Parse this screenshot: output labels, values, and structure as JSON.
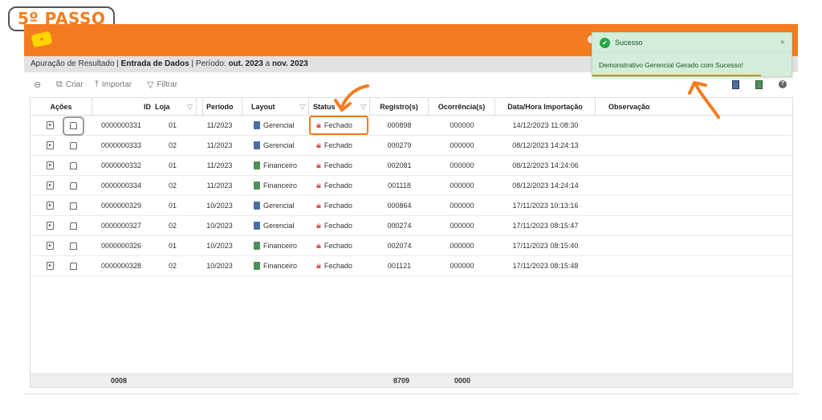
{
  "step_badge": "5º PASSO",
  "breadcrumb": {
    "prefix": "Apuração de Resultado | ",
    "section": "Entrada de Dados",
    "period_label": " | Período: ",
    "period_start": "out. 2023",
    "period_sep": " a ",
    "period_end": "nov. 2023"
  },
  "toolbar": {
    "create_label": "Criar",
    "import_label": "Importar",
    "filter_label": "Filtrar"
  },
  "table": {
    "columns": [
      "Ações",
      "ID",
      "Loja",
      "Período",
      "Layout",
      "Status",
      "Registro(s)",
      "Ocorrência(s)",
      "Data/Hora Importação",
      "Observação"
    ],
    "rows": [
      {
        "id": "0000000331",
        "loja": "01",
        "periodo": "11/2023",
        "layout": "Gerencial",
        "status": "Fechado",
        "registros": "000898",
        "ocorrencias": "000000",
        "datahora": "14/12/2023 11:08:30",
        "obs": ""
      },
      {
        "id": "0000000333",
        "loja": "02",
        "periodo": "11/2023",
        "layout": "Gerencial",
        "status": "Fechado",
        "registros": "000279",
        "ocorrencias": "000000",
        "datahora": "08/12/2023 14:24:13",
        "obs": ""
      },
      {
        "id": "0000000332",
        "loja": "01",
        "periodo": "11/2023",
        "layout": "Financeiro",
        "status": "Fechado",
        "registros": "002081",
        "ocorrencias": "000000",
        "datahora": "08/12/2023 14:24:06",
        "obs": ""
      },
      {
        "id": "0000000334",
        "loja": "02",
        "periodo": "11/2023",
        "layout": "Financeiro",
        "status": "Fechado",
        "registros": "001118",
        "ocorrencias": "000000",
        "datahora": "08/12/2023 14:24:14",
        "obs": ""
      },
      {
        "id": "0000000329",
        "loja": "01",
        "periodo": "10/2023",
        "layout": "Gerencial",
        "status": "Fechado",
        "registros": "000864",
        "ocorrencias": "000000",
        "datahora": "17/11/2023 10:13:16",
        "obs": ""
      },
      {
        "id": "0000000327",
        "loja": "02",
        "periodo": "10/2023",
        "layout": "Gerencial",
        "status": "Fechado",
        "registros": "000274",
        "ocorrencias": "000000",
        "datahora": "17/11/2023 08:15:47",
        "obs": ""
      },
      {
        "id": "0000000326",
        "loja": "01",
        "periodo": "10/2023",
        "layout": "Financeiro",
        "status": "Fechado",
        "registros": "002074",
        "ocorrencias": "000000",
        "datahora": "17/11/2023 08:15:40",
        "obs": ""
      },
      {
        "id": "0000000328",
        "loja": "02",
        "periodo": "10/2023",
        "layout": "Financeiro",
        "status": "Fechado",
        "registros": "001121",
        "ocorrencias": "000000",
        "datahora": "17/11/2023 08:15:48",
        "obs": ""
      }
    ],
    "footer": {
      "count": "0008",
      "registros_total": "8709",
      "ocorrencias_total": "0000"
    }
  },
  "toast": {
    "title": "Sucesso",
    "message": "Demonstrativo Gerencial Gerado com Sucesso!",
    "close": "×"
  },
  "icons": {
    "back": "back-arrow-icon",
    "create": "create-icon",
    "import": "import-icon",
    "filter": "filter-icon",
    "export_1": "bookmark-blue-icon",
    "export_2": "bookmark-green-icon",
    "help": "help-icon"
  },
  "colors": {
    "brand_orange": "#f47c20",
    "success_bg": "#d4edda",
    "success_icon": "#28a745",
    "lock_red": "#d9534f",
    "gerencial_icon": "#4a6fa5",
    "financeiro_icon": "#4f8f5a"
  }
}
